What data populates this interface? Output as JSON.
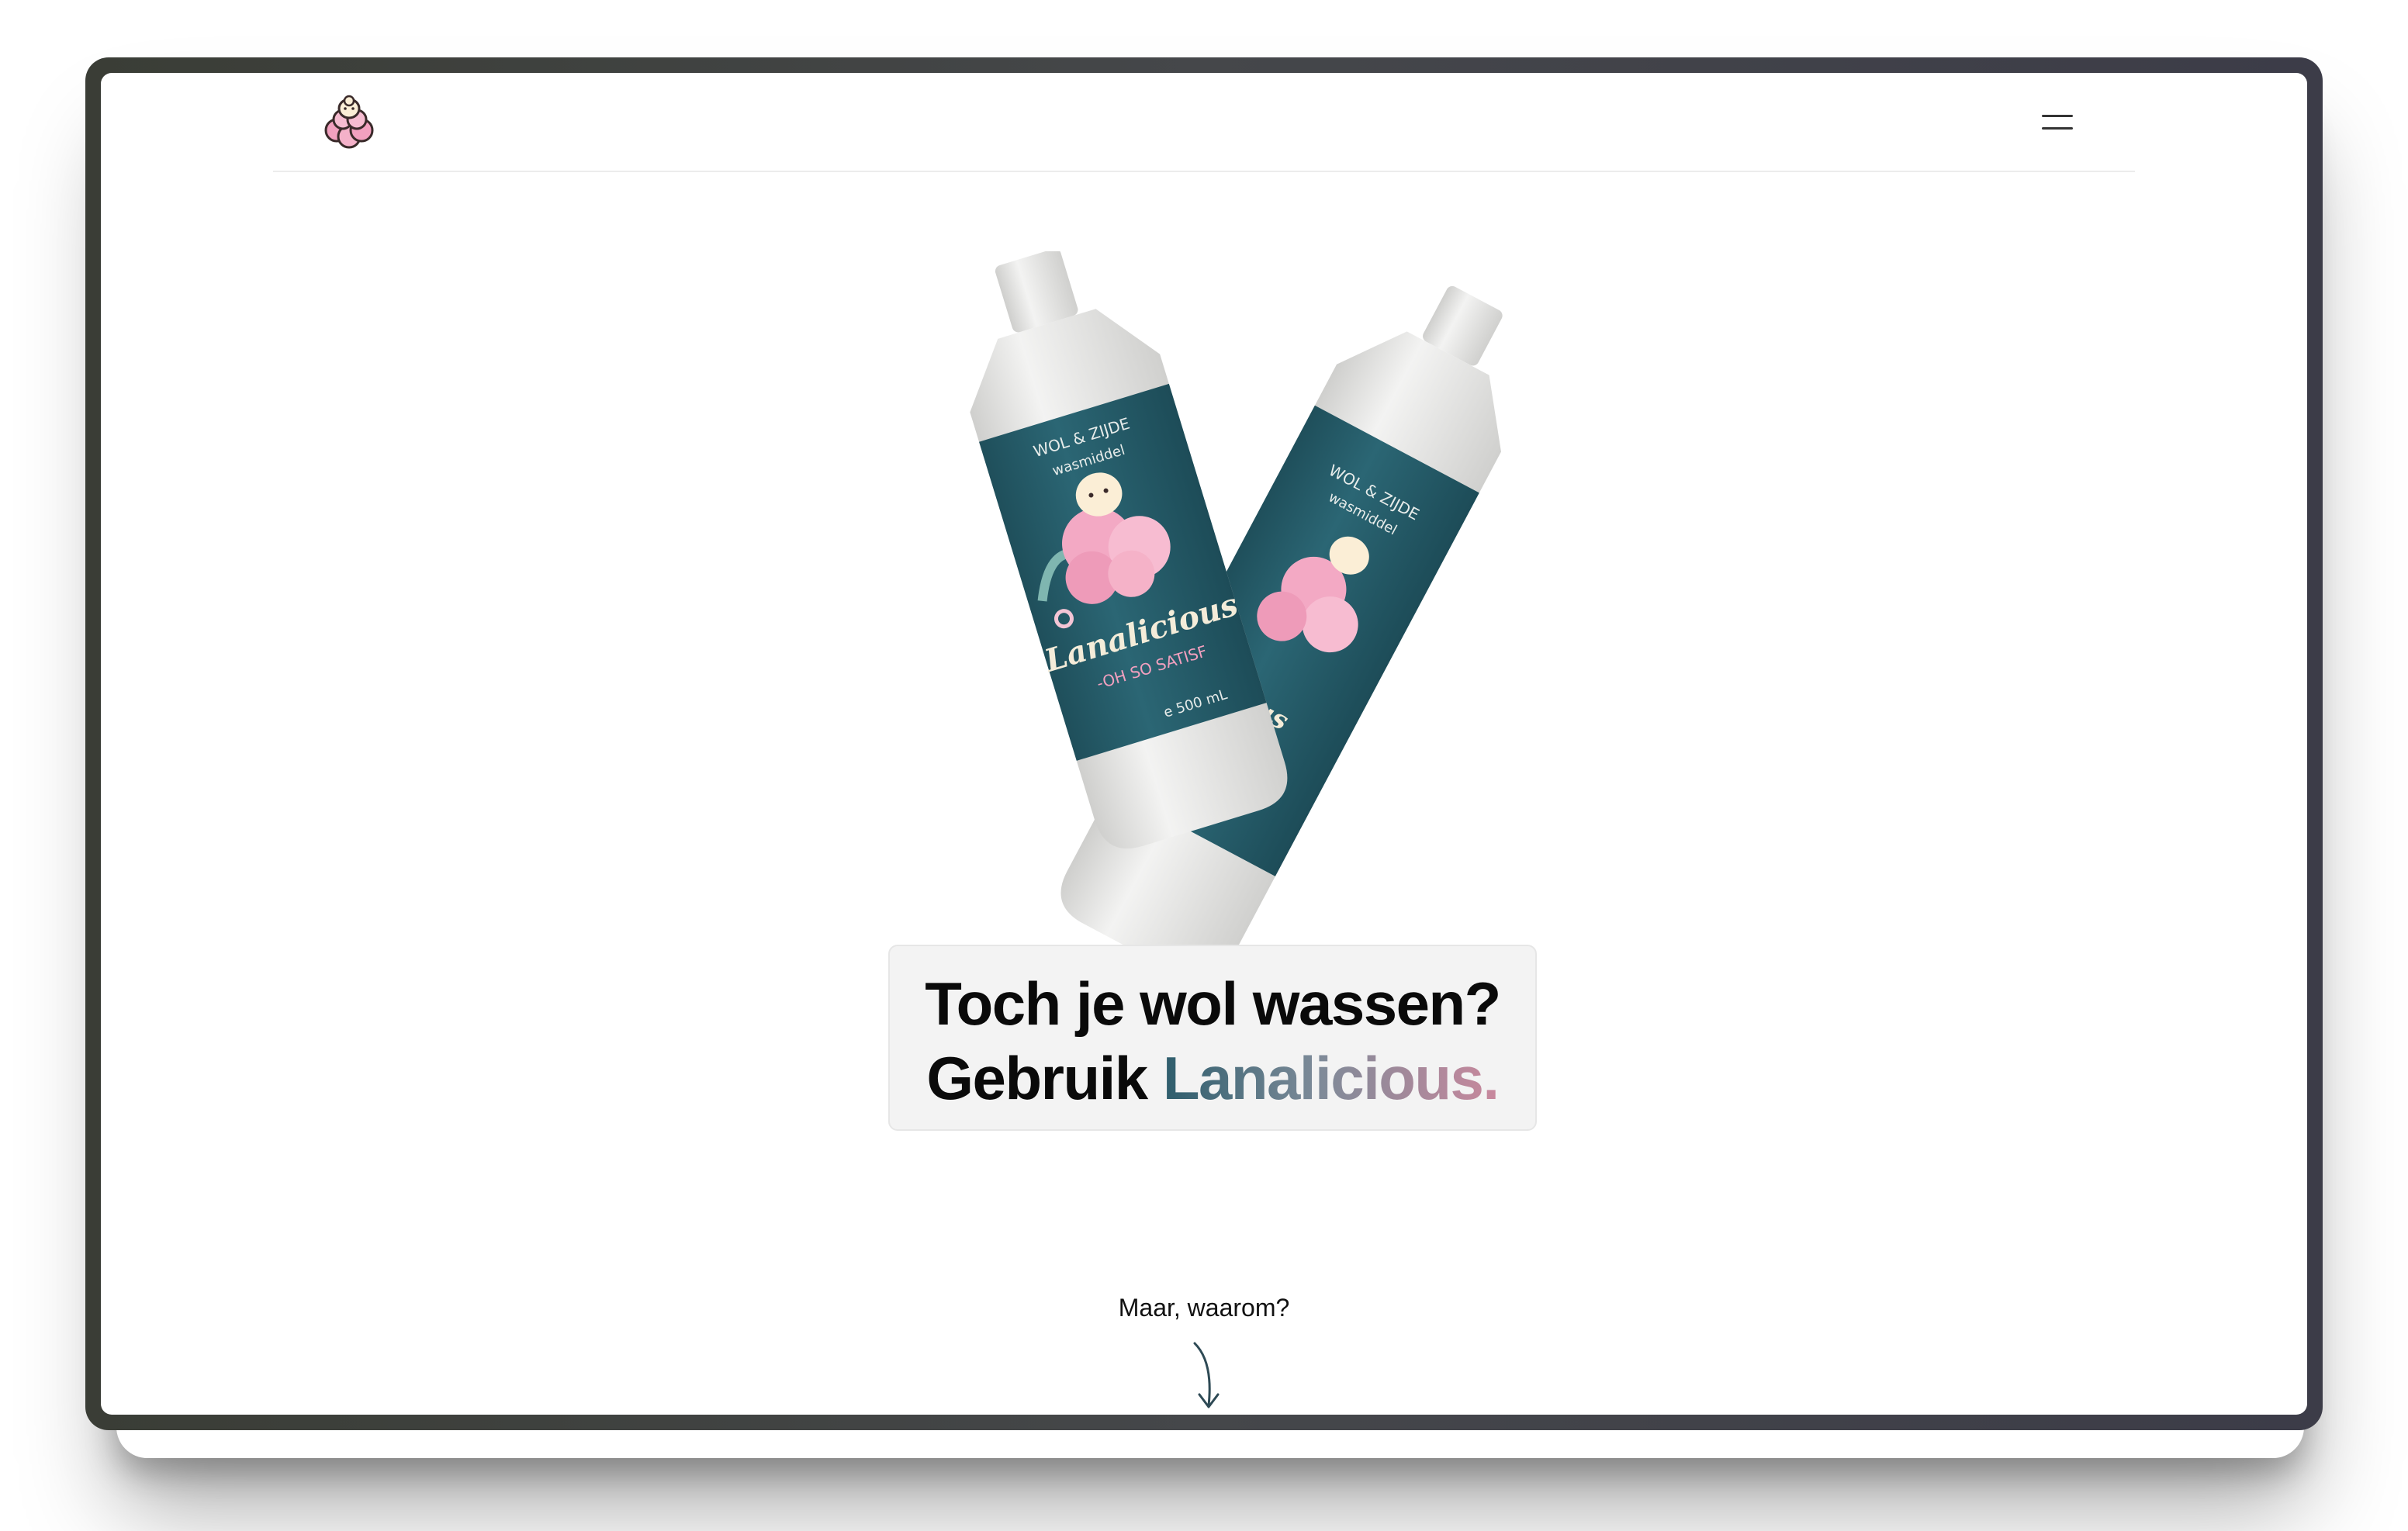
{
  "nav": {
    "logo_icon": "sheep-logo-icon",
    "menu_icon": "hamburger-menu-icon"
  },
  "hero": {
    "line1": "Toch je wol wassen?",
    "line2_prefix": "Gebruik ",
    "line2_brand": "Lanalicious."
  },
  "product": {
    "label_top": "WOL & ZIJDE",
    "label_sub": "wasmiddel",
    "brand": "Lanalicious",
    "tagline": "-OH SO SATISF",
    "volume": "e 500 mL"
  },
  "cta": {
    "label": "Maar, waarom?",
    "icon": "arrow-down-icon"
  },
  "colors": {
    "label_teal": "#265e6b",
    "bottle_white": "#e6e6e4",
    "accent_pink": "#f2a7c3",
    "brand_gradient_start": "#2e5d6c",
    "brand_gradient_end": "#c9889d"
  }
}
